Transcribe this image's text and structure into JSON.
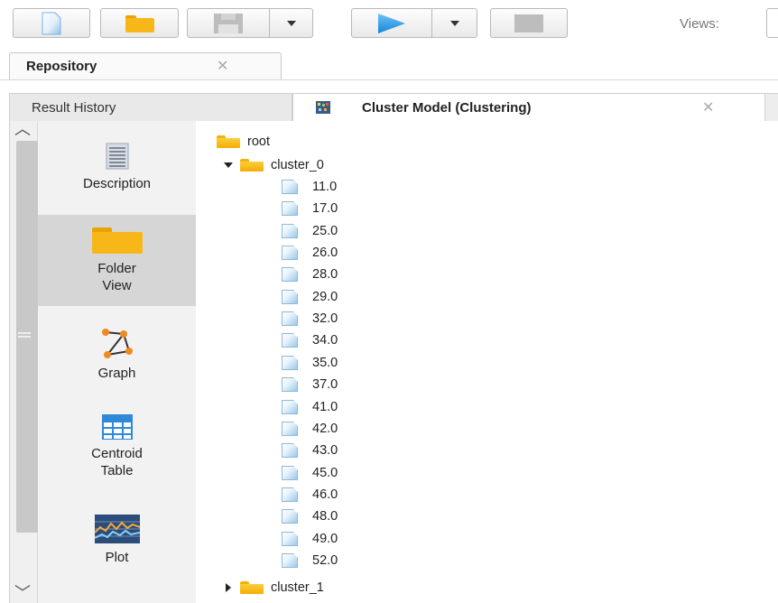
{
  "toolbar": {
    "views_label": "Views:"
  },
  "repository_tab": {
    "label": "Repository",
    "close": "✕"
  },
  "result_tabs": [
    {
      "label": "Result History",
      "selected": false
    },
    {
      "label": "Cluster Model (Clustering)",
      "selected": true,
      "close": "✕"
    }
  ],
  "scroll": {
    "up": "︿",
    "down": "﹀"
  },
  "views": [
    {
      "label": "Description",
      "icon": "description-icon",
      "selected": false
    },
    {
      "label": "Folder\nView",
      "icon": "folder-icon",
      "selected": true
    },
    {
      "label": "Graph",
      "icon": "graph-icon",
      "selected": false
    },
    {
      "label": "Centroid\nTable",
      "icon": "table-icon",
      "selected": false
    },
    {
      "label": "Plot",
      "icon": "plot-icon",
      "selected": false
    }
  ],
  "tree": {
    "root": "root",
    "cluster_0": {
      "label": "cluster_0",
      "expanded": true,
      "items": [
        "11.0",
        "17.0",
        "25.0",
        "26.0",
        "28.0",
        "29.0",
        "32.0",
        "34.0",
        "35.0",
        "37.0",
        "41.0",
        "42.0",
        "43.0",
        "45.0",
        "46.0",
        "48.0",
        "49.0",
        "52.0"
      ]
    },
    "cluster_1": {
      "label": "cluster_1",
      "expanded": false
    }
  },
  "colors": {
    "folder": "#f4ac06",
    "play": "#1e90e0",
    "accent_orange": "#f08a1c"
  }
}
